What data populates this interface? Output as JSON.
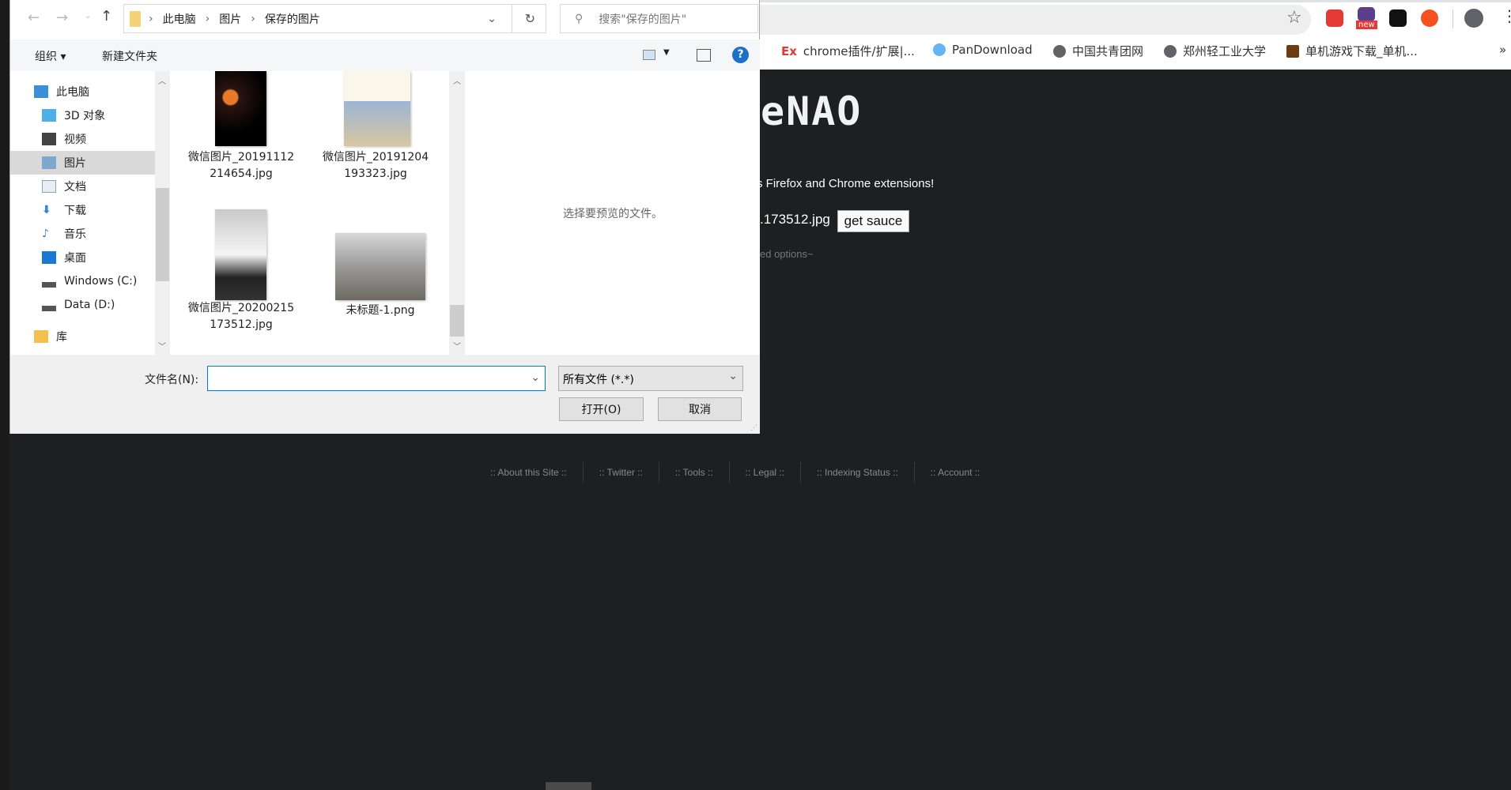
{
  "browser": {
    "bookmarks": [
      {
        "label": "chrome插件/扩展|...",
        "icon": "Ex"
      },
      {
        "label": "PanDownload",
        "icon": "cloud-icon"
      },
      {
        "label": "中国共青团网",
        "icon": "globe-icon"
      },
      {
        "label": "郑州轻工业大学",
        "icon": "globe-icon"
      },
      {
        "label": "单机游戏下载_单机...",
        "icon": "game-icon"
      }
    ],
    "more": "»",
    "ext_badge": "new"
  },
  "page": {
    "title_fragment": "eNAO",
    "promo": "s Firefox and Chrome extensions!",
    "file_value": ".173512.jpg",
    "submit_label": "get sauce",
    "advanced": "ed options~",
    "footer": [
      ":: About this Site ::",
      ":: Twitter ::",
      ":: Tools ::",
      ":: Legal ::",
      ":: Indexing Status ::",
      ":: Account ::"
    ]
  },
  "dialog": {
    "breadcrumb": [
      "此电脑",
      "图片",
      "保存的图片"
    ],
    "search_placeholder": "搜索\"保存的图片\"",
    "organize": "组织 ▾",
    "new_folder": "新建文件夹",
    "nav": [
      {
        "label": "此电脑"
      },
      {
        "label": "3D 对象"
      },
      {
        "label": "视频"
      },
      {
        "label": "图片"
      },
      {
        "label": "文档"
      },
      {
        "label": "下载"
      },
      {
        "label": "音乐"
      },
      {
        "label": "桌面"
      },
      {
        "label": "Windows (C:)"
      },
      {
        "label": "Data (D:)"
      },
      {
        "label": "库"
      }
    ],
    "files": [
      {
        "name": "微信图片_20191112214654.jpg"
      },
      {
        "name": "微信图片_20191204193323.jpg"
      },
      {
        "name": "微信图片_20200215173512.jpg"
      },
      {
        "name": "未标题-1.png"
      }
    ],
    "preview_text": "选择要预览的文件。",
    "filename_label": "文件名(N):",
    "filename_value": "",
    "filter": "所有文件 (*.*)",
    "open": "打开(O)",
    "cancel": "取消"
  },
  "colors": {
    "page_bg": "#1e1f21",
    "dialog_bg": "#f0f0f0",
    "selected": "#d9d9d9"
  }
}
